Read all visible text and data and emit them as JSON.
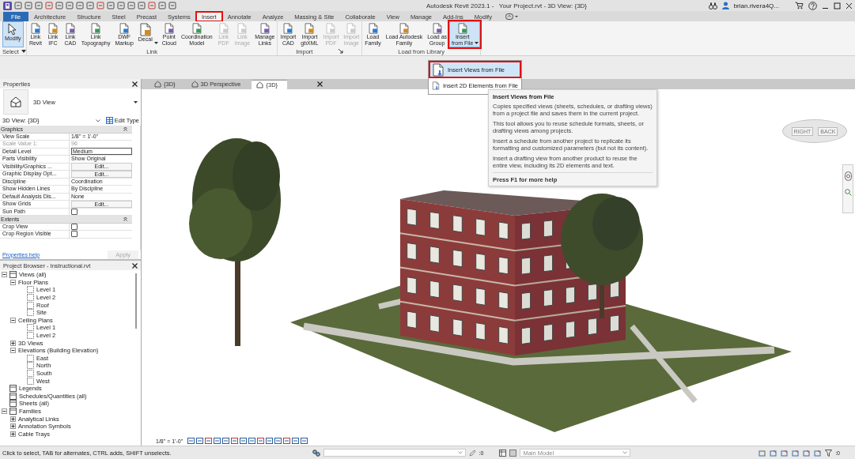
{
  "title_bar": {
    "title": "Autodesk Revit 2023.1 -   Your Project.rvt - 3D View: {3D}",
    "user": "brian.rivera4Q..."
  },
  "ribbon_tabs": [
    {
      "label": "File",
      "kind": "file",
      "selected": false,
      "highlighted": false
    },
    {
      "label": "Architecture",
      "kind": "tab",
      "selected": false,
      "highlighted": false
    },
    {
      "label": "Structure",
      "kind": "tab",
      "selected": false,
      "highlighted": false
    },
    {
      "label": "Steel",
      "kind": "tab",
      "selected": false,
      "highlighted": false
    },
    {
      "label": "Precast",
      "kind": "tab",
      "selected": false,
      "highlighted": false
    },
    {
      "label": "Systems",
      "kind": "tab",
      "selected": false,
      "highlighted": false
    },
    {
      "label": "Insert",
      "kind": "tab",
      "selected": true,
      "highlighted": true
    },
    {
      "label": "Annotate",
      "kind": "tab",
      "selected": false,
      "highlighted": false
    },
    {
      "label": "Analyze",
      "kind": "tab",
      "selected": false,
      "highlighted": false
    },
    {
      "label": "Massing & Site",
      "kind": "tab",
      "selected": false,
      "highlighted": false
    },
    {
      "label": "Collaborate",
      "kind": "tab",
      "selected": false,
      "highlighted": false
    },
    {
      "label": "View",
      "kind": "tab",
      "selected": false,
      "highlighted": false
    },
    {
      "label": "Manage",
      "kind": "tab",
      "selected": false,
      "highlighted": false
    },
    {
      "label": "Add-Ins",
      "kind": "tab",
      "selected": false,
      "highlighted": false
    },
    {
      "label": "Modify",
      "kind": "tab",
      "selected": false,
      "highlighted": false
    }
  ],
  "ribbon_panels": [
    {
      "label": "Select",
      "dropdown": true,
      "launcher": false,
      "buttons": [
        {
          "label": "Modify",
          "selected": true,
          "disabled": false,
          "dropdown": false,
          "highlighted": false
        }
      ]
    },
    {
      "label": "Link",
      "dropdown": false,
      "launcher": false,
      "buttons": [
        {
          "label": "Link\nRevit",
          "selected": false,
          "disabled": false,
          "dropdown": false,
          "highlighted": false
        },
        {
          "label": "Link\nIFC",
          "selected": false,
          "disabled": false,
          "dropdown": false,
          "highlighted": false
        },
        {
          "label": "Link\nCAD",
          "selected": false,
          "disabled": false,
          "dropdown": false,
          "highlighted": false
        },
        {
          "label": "Link\nTopography",
          "selected": false,
          "disabled": false,
          "dropdown": false,
          "highlighted": false
        },
        {
          "label": "DWF\nMarkup",
          "selected": false,
          "disabled": false,
          "dropdown": false,
          "highlighted": false
        },
        {
          "label": "Decal",
          "selected": false,
          "disabled": false,
          "dropdown": true,
          "highlighted": false
        },
        {
          "label": "Point\nCloud",
          "selected": false,
          "disabled": false,
          "dropdown": false,
          "highlighted": false
        },
        {
          "label": "Coordination\nModel",
          "selected": false,
          "disabled": false,
          "dropdown": false,
          "highlighted": false
        },
        {
          "label": "Link\nPDF",
          "selected": false,
          "disabled": true,
          "dropdown": false,
          "highlighted": false
        },
        {
          "label": "Link\nImage",
          "selected": false,
          "disabled": true,
          "dropdown": false,
          "highlighted": false
        },
        {
          "label": "Manage\nLinks",
          "selected": false,
          "disabled": false,
          "dropdown": false,
          "highlighted": false
        }
      ]
    },
    {
      "label": "Import",
      "dropdown": false,
      "launcher": true,
      "buttons": [
        {
          "label": "Import\nCAD",
          "selected": false,
          "disabled": false,
          "dropdown": false,
          "highlighted": false
        },
        {
          "label": "Import\ngbXML",
          "selected": false,
          "disabled": false,
          "dropdown": false,
          "highlighted": false
        },
        {
          "label": "Import\nPDF",
          "selected": false,
          "disabled": true,
          "dropdown": false,
          "highlighted": false
        },
        {
          "label": "Import\nImage",
          "selected": false,
          "disabled": true,
          "dropdown": false,
          "highlighted": false
        }
      ]
    },
    {
      "label": "Load from Library",
      "dropdown": false,
      "launcher": false,
      "buttons": [
        {
          "label": "Load\nFamily",
          "selected": false,
          "disabled": false,
          "dropdown": false,
          "highlighted": false
        },
        {
          "label": "Load Autodesk\nFamily",
          "selected": false,
          "disabled": false,
          "dropdown": false,
          "highlighted": false
        },
        {
          "label": "Load as\nGroup",
          "selected": false,
          "disabled": false,
          "dropdown": false,
          "highlighted": false
        },
        {
          "label": "Insert\nfrom File",
          "selected": true,
          "disabled": false,
          "dropdown": true,
          "highlighted": true
        }
      ]
    }
  ],
  "insert_menu": [
    {
      "label": "Insert Views from File",
      "selected": true,
      "highlighted": true
    },
    {
      "label": "Insert 2D Elements from File",
      "selected": false,
      "highlighted": false
    }
  ],
  "tooltip": {
    "title": "Insert Views from File",
    "paragraphs": [
      "Copies specified views (sheets, schedules, or drafting views) from a project file and saves them in the current project.",
      "This tool allows you to reuse schedule formats, sheets, or drafting views among projects.",
      "Insert a schedule from another project to replicate its formatting and customized parameters (but not its content).",
      "Insert a drafting view from another product to reuse the entire view, including its 2D elements and text."
    ],
    "footer": "Press F1 for more help"
  },
  "properties": {
    "title": "Properties",
    "type_name": "3D View",
    "instance": "3D View: {3D}",
    "edit_type": "Edit Type",
    "groups": [
      {
        "label": "Graphics",
        "rows": [
          {
            "name": "View Scale",
            "value": "1/8\" = 1'-0\"",
            "kind": "text"
          },
          {
            "name": "Scale Value    1:",
            "value": "96",
            "kind": "readonly"
          },
          {
            "name": "Detail Level",
            "value": "Medium",
            "kind": "field"
          },
          {
            "name": "Parts Visibility",
            "value": "Show Original",
            "kind": "text"
          },
          {
            "name": "Visibility/Graphics ...",
            "value": "Edit...",
            "kind": "button"
          },
          {
            "name": "Graphic Display Opt...",
            "value": "Edit...",
            "kind": "button"
          },
          {
            "name": "Discipline",
            "value": "Coordination",
            "kind": "text"
          },
          {
            "name": "Show Hidden Lines",
            "value": "By Discipline",
            "kind": "text"
          },
          {
            "name": "Default Analysis Dis...",
            "value": "None",
            "kind": "text"
          },
          {
            "name": "Show Grids",
            "value": "Edit...",
            "kind": "button"
          },
          {
            "name": "Sun Path",
            "kind": "checkbox",
            "checked": false
          }
        ]
      },
      {
        "label": "Extents",
        "rows": [
          {
            "name": "Crop View",
            "kind": "checkbox",
            "checked": false
          },
          {
            "name": "Crop Region Visible",
            "kind": "checkbox",
            "checked": false
          }
        ]
      }
    ],
    "help_link": "Properties help",
    "apply": "Apply"
  },
  "project_browser": {
    "title": "Project Browser - Instructional.rvt",
    "tree": [
      {
        "label": "Views (all)",
        "expanded": true,
        "children": [
          {
            "label": "Floor Plans",
            "expanded": true,
            "children": [
              {
                "label": "Level 1"
              },
              {
                "label": "Level 2"
              },
              {
                "label": "Roof"
              },
              {
                "label": "Site"
              }
            ]
          },
          {
            "label": "Ceiling Plans",
            "expanded": true,
            "children": [
              {
                "label": "Level 1"
              },
              {
                "label": "Level 2"
              }
            ]
          },
          {
            "label": "3D Views",
            "expanded": false
          },
          {
            "label": "Elevations (Building Elevation)",
            "expanded": true,
            "children": [
              {
                "label": "East"
              },
              {
                "label": "North"
              },
              {
                "label": "South"
              },
              {
                "label": "West"
              }
            ]
          }
        ]
      },
      {
        "label": "Legends"
      },
      {
        "label": "Schedules/Quantities (all)"
      },
      {
        "label": "Sheets (all)"
      },
      {
        "label": "Families",
        "expanded": true,
        "children": [
          {
            "label": "Analytical Links",
            "expanded": false
          },
          {
            "label": "Annotation Symbols",
            "expanded": false
          },
          {
            "label": "Cable Trays",
            "expanded": false
          }
        ]
      }
    ]
  },
  "view_tabs": [
    {
      "label": "{3D}",
      "selected": false,
      "closable": false
    },
    {
      "label": "3D Perspective",
      "selected": false,
      "closable": false
    },
    {
      "label": "{3D}",
      "selected": true,
      "closable": true
    }
  ],
  "view_cube": {
    "faces": [
      "RIGHT",
      "BACK"
    ]
  },
  "view_scale": "1/8\" = 1'-0\"",
  "status_bar": {
    "message": "Click to select, TAB for alternates, CTRL adds, SHIFT unselects.",
    "workset_count": ":0",
    "design_option": "Main Model",
    "filter_count": ":0"
  }
}
